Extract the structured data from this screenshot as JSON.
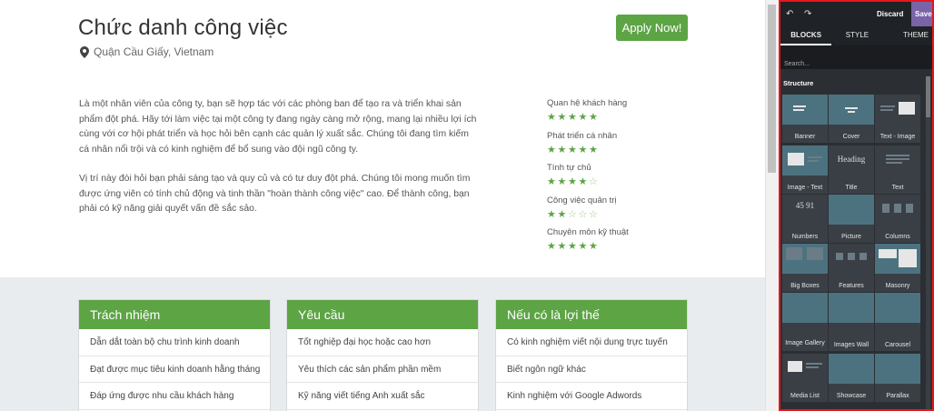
{
  "job": {
    "title": "Chức danh công việc",
    "location": "Quận Cầu Giấy, Vietnam",
    "apply_label": "Apply Now!"
  },
  "description": {
    "p1": "Là một nhân viên của công ty, bạn sẽ hợp tác với các phòng ban để tạo ra và triển khai sản phẩm đột phá. Hãy tới làm việc tại một công ty đang ngày càng mở rộng, mang lại nhiều lợi ích cùng với cơ hội phát triển và học hỏi bên cạnh các quản lý xuất sắc. Chúng tôi đang tìm kiếm cá nhân nổi trội và có kinh nghiệm để bổ sung vào đội ngũ công ty.",
    "p2": "Vị trí này đòi hỏi bạn phải sáng tạo và quy củ và có tư duy đột phá. Chúng tôi mong muốn tìm được ứng viên có tính chủ động và tinh thần \"hoàn thành công việc\" cao. Để thành công, bạn phải có kỹ năng giải quyết vấn đề sắc sảo."
  },
  "skills": [
    {
      "label": "Quan hệ khách hàng",
      "rating": 5
    },
    {
      "label": "Phát triển cá nhân",
      "rating": 5
    },
    {
      "label": "Tính tự chủ",
      "rating": 4
    },
    {
      "label": "Công việc quản trị",
      "rating": 2
    },
    {
      "label": "Chuyên môn kỹ thuật",
      "rating": 5
    }
  ],
  "cards": [
    {
      "title": "Trách nhiệm",
      "items": [
        "Dẫn dắt toàn bộ chu trình kinh doanh",
        "Đạt được mục tiêu kinh doanh hằng tháng",
        "Đáp ứng được nhu cầu khách hàng"
      ]
    },
    {
      "title": "Yêu cầu",
      "items": [
        "Tốt nghiệp đại học hoặc cao hơn",
        "Yêu thích các sản phẩm phần mềm",
        "Kỹ năng viết tiếng Anh xuất sắc"
      ]
    },
    {
      "title": "Nếu có là lợi thế",
      "items": [
        "Có kinh nghiệm viết nội dung trực tuyến",
        "Biết ngôn ngữ khác",
        "Kinh nghiệm với Google Adwords"
      ]
    }
  ],
  "panel": {
    "discard": "Discard",
    "save": "Save",
    "tabs": [
      "BLOCKS",
      "STYLE",
      "THEME"
    ],
    "search_placeholder": "Search...",
    "section": "Structure",
    "blocks": [
      "Banner",
      "Cover",
      "Text - Image",
      "Image - Text",
      "Title",
      "Text",
      "Numbers",
      "Picture",
      "Columns",
      "Big Boxes",
      "Features",
      "Masonry",
      "Image Gallery",
      "Images Wall",
      "Carousel",
      "Media List",
      "Showcase",
      "Parallax"
    ],
    "title_thumb": "Heading",
    "numbers_thumb": [
      "45",
      "91"
    ]
  },
  "colors": {
    "accent": "#5da445",
    "panel_bg": "#2b2f33",
    "highlight_border": "#e8161d",
    "save_bg": "#7a63a6"
  }
}
